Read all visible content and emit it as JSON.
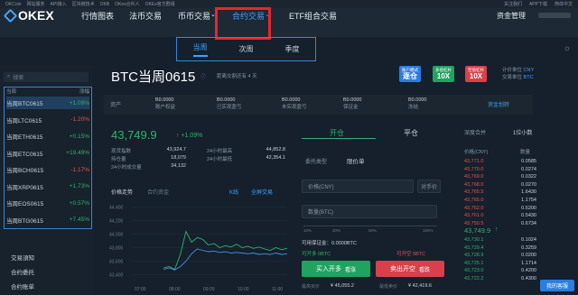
{
  "topbar": {
    "items": [
      "OKCoin",
      "网站服务",
      "API接入",
      "区块链技术",
      "OKB",
      "OKex合伙人",
      "OKEx官方群组"
    ],
    "right": [
      "关注我们",
      "APP下载",
      "简体中文"
    ]
  },
  "nav": {
    "logo": "OKEX",
    "items": [
      "行情图表",
      "法币交易",
      "币币交易",
      "合约交易",
      "ETF组合交易"
    ],
    "assets": "资金管理"
  },
  "subtabs": [
    "当周",
    "次周",
    "季度"
  ],
  "sidebar": {
    "search_placeholder": "搜索",
    "head_left": "当周",
    "head_right": "涨幅",
    "instruments": [
      {
        "name": "当周BTC0615",
        "change": "+1.09%",
        "dir": "up",
        "selected": true
      },
      {
        "name": "当周LTC0615",
        "change": "-1.20%",
        "dir": "down"
      },
      {
        "name": "当周ETH0615",
        "change": "+0.15%",
        "dir": "up"
      },
      {
        "name": "当周ETC0615",
        "change": "+19.49%",
        "dir": "up"
      },
      {
        "name": "当周BCH0615",
        "change": "-1.17%",
        "dir": "down"
      },
      {
        "name": "当周XRP0615",
        "change": "+1.73%",
        "dir": "up"
      },
      {
        "name": "当周EOS0615",
        "change": "+0.57%",
        "dir": "up"
      },
      {
        "name": "当周BTG0615",
        "change": "+7.45%",
        "dir": "up"
      }
    ],
    "footer": [
      "交易須知",
      "合约委托",
      "合约账单"
    ]
  },
  "header": {
    "pair": "BTC当周0615",
    "info": "距离交割还有 4 天",
    "buttons": [
      {
        "top": "账户模式",
        "main": "逐仓",
        "color": "#2a7de1"
      },
      {
        "top": "多倍杠杆",
        "main": "10X",
        "color": "#1fa35f"
      },
      {
        "top": "空倍杠杆",
        "main": "10X",
        "color": "#d9404a"
      }
    ],
    "unit_label": "计价单位",
    "unit_value": "CNY",
    "unit2_label": "交易单位",
    "unit2_value": "BTC"
  },
  "balances": {
    "label": "资产",
    "items": [
      {
        "value": "B0.0000",
        "label": "账户权益"
      },
      {
        "value": "B0.0000",
        "label": "已实现盈亏"
      },
      {
        "value": "B0.0000",
        "label": "未实现盈亏"
      },
      {
        "value": "B0.0000",
        "label": "保证金"
      },
      {
        "value": "B0.0000",
        "label": "冻结"
      }
    ],
    "transfer": "资金划转"
  },
  "ticker": {
    "price": "43,749.9",
    "arrow": "↑",
    "pct": "+1.09%",
    "stats": [
      {
        "label": "现货指数",
        "value": "43,924.7"
      },
      {
        "label": "持仓量",
        "value": "18,079"
      },
      {
        "label": "24小时成交量",
        "value": "34,132"
      },
      {
        "label": "24小时最高",
        "value": "44,852.8"
      },
      {
        "label": "24小时最低",
        "value": "42,354.1"
      }
    ]
  },
  "chart_data": {
    "type": "line",
    "tabs": [
      "价格走势",
      "合约资金"
    ],
    "links": [
      "K线",
      "全屏交易"
    ],
    "x": [
      "07:00",
      "08:00",
      "09:00",
      "10:00",
      "11:00"
    ],
    "ylim": [
      43300,
      44500
    ],
    "yticks": [
      43400,
      43600,
      43800,
      44000,
      44200,
      44400
    ],
    "series": [
      {
        "values": [
          43500,
          43520,
          43480,
          43700,
          44040,
          43880,
          43950,
          43920,
          43840,
          43860,
          43800,
          43830,
          43810,
          43850,
          43800,
          43820,
          43790,
          43810,
          43780,
          43760,
          43800,
          43770,
          43790
        ],
        "color": "#2fb36b"
      },
      {
        "values": [
          43480,
          43500,
          43470,
          43520,
          43600,
          43710,
          43780,
          43760,
          43740,
          43750,
          43730,
          43740,
          43720,
          43730,
          43720,
          43710,
          43720,
          43700,
          43710,
          43700,
          43720,
          43700,
          43710
        ],
        "color": "#4a8fe0"
      }
    ]
  },
  "trade": {
    "tabs": [
      "开仓",
      "平仓"
    ],
    "order_type_label": "委托类型",
    "order_type_value": "限价单",
    "price_label": "价格(CNY)",
    "price_btn": "对手价",
    "qty_label": "数量(BTC)",
    "pct_marks": [
      "10%",
      "20%",
      "50%",
      "100%"
    ],
    "open_label": "可用保证金：0.0000BTC",
    "long_label": "可开多 0BTC",
    "short_label": "可开空 0BTC",
    "buy": "买入开多",
    "buy_tag": "看涨",
    "sell": "卖出开空",
    "sell_tag": "看跌",
    "buy_price": "¥ 45,055.2",
    "sell_price": "¥ 42,419.6",
    "est_label": "最高买价",
    "est_label2": "最低卖价"
  },
  "orderbook": {
    "head_left": "深度合并",
    "head_right": "1位小数",
    "col_price": "价格(CNY)",
    "col_qty": "数量",
    "asks": [
      [
        "43,771.0",
        "0.0585"
      ],
      [
        "43,770.0",
        "0.0274"
      ],
      [
        "43,769.0",
        "0.0322"
      ],
      [
        "43,768.0",
        "0.0270"
      ],
      [
        "43,765.5",
        "1.6430"
      ],
      [
        "43,765.0",
        "1.1754"
      ],
      [
        "43,762.0",
        "0.5200"
      ],
      [
        "43,761.0",
        "0.5430"
      ],
      [
        "43,750.5",
        "0.6734"
      ]
    ],
    "mid": "43,749.9",
    "bids": [
      [
        "43,730.1",
        "0.1024"
      ],
      [
        "43,729.4",
        "0.3259"
      ],
      [
        "43,728.9",
        "0.0200"
      ],
      [
        "43,725.1",
        "1.1714"
      ],
      [
        "43,723.0",
        "0.4200"
      ],
      [
        "43,722.2",
        "0.4300"
      ]
    ],
    "kefu": "我的客服"
  },
  "colors": {
    "up": "#2fb36b",
    "down": "#e05555",
    "accent": "#3fa0ff",
    "highlight": "#e8262c"
  }
}
